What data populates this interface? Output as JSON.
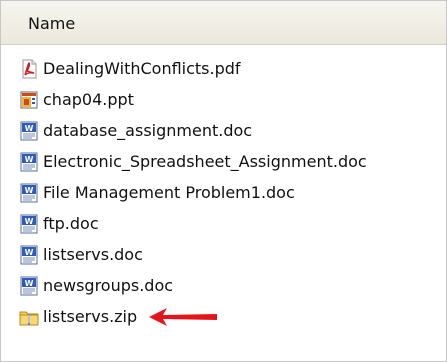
{
  "header": {
    "name_column_label": "Name"
  },
  "files": [
    {
      "name": "DealingWithConflicts.pdf",
      "icon": "pdf-icon"
    },
    {
      "name": "chap04.ppt",
      "icon": "ppt-icon"
    },
    {
      "name": "database_assignment.doc",
      "icon": "word-doc-icon"
    },
    {
      "name": "Electronic_Spreadsheet_Assignment.doc",
      "icon": "word-doc-icon"
    },
    {
      "name": "File Management Problem1.doc",
      "icon": "word-doc-icon"
    },
    {
      "name": "ftp.doc",
      "icon": "word-doc-icon"
    },
    {
      "name": "listservs.doc",
      "icon": "word-doc-icon"
    },
    {
      "name": "newsgroups.doc",
      "icon": "word-doc-icon"
    },
    {
      "name": "listservs.zip",
      "icon": "zip-folder-icon"
    }
  ],
  "annotation": {
    "arrow_icon": "red-arrow-icon",
    "arrow_color": "#e3151a",
    "points_to": "listservs.zip"
  }
}
